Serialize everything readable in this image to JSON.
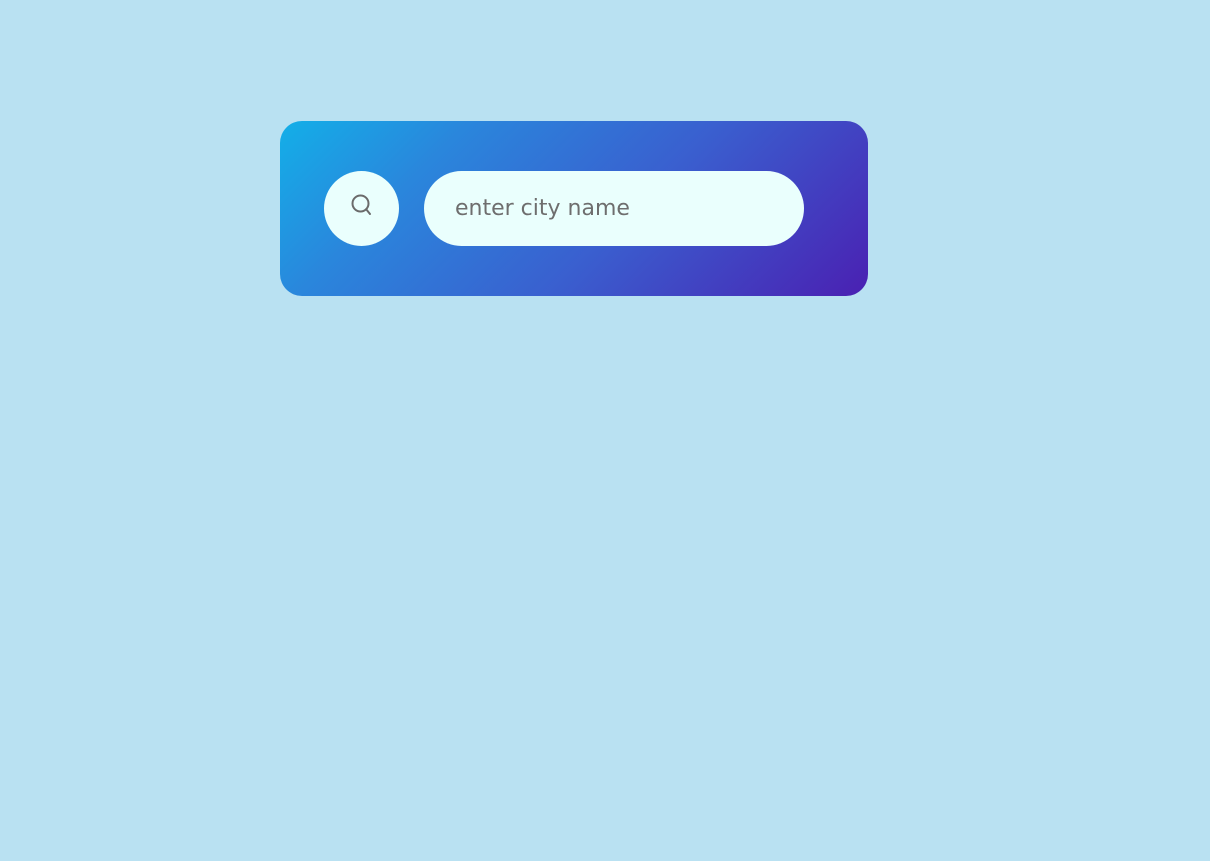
{
  "search": {
    "placeholder": "enter city name",
    "value": "",
    "icon": "search-icon"
  },
  "colors": {
    "page_background": "#b9e1f2",
    "card_gradient_start": "#13afe8",
    "card_gradient_end": "#4a20b2",
    "control_background": "#eafffd",
    "placeholder_text": "#6e6e6e",
    "icon_stroke": "#6b6b6b"
  }
}
